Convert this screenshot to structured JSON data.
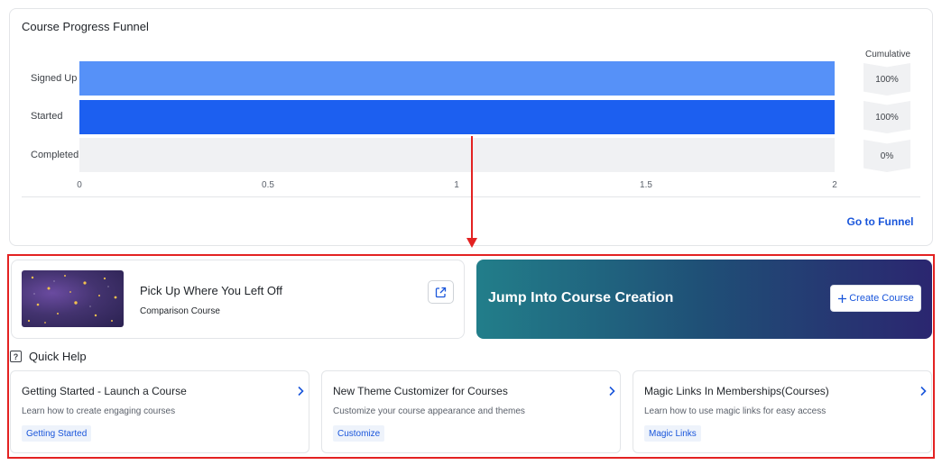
{
  "funnel": {
    "title": "Course Progress Funnel",
    "cumulative_header": "Cumulative",
    "rows": [
      {
        "label": "Signed Up",
        "value": 2,
        "cumulative": "100%",
        "color": "#5691f8"
      },
      {
        "label": "Started",
        "value": 2,
        "cumulative": "100%",
        "color": "#1c5ff0"
      },
      {
        "label": "Completed",
        "value": 0,
        "cumulative": "0%",
        "color": "#f0f1f3"
      }
    ],
    "ticks": [
      "0",
      "0.5",
      "1",
      "1.5",
      "2"
    ],
    "link_label": "Go to Funnel"
  },
  "resume": {
    "title": "Pick Up Where You Left Off",
    "course_name": "Comparison Course",
    "open_icon": "external-link-icon"
  },
  "create": {
    "title": "Jump Into Course Creation",
    "button_label": "Create Course",
    "button_icon": "plus-icon"
  },
  "quick_help": {
    "title": "Quick Help",
    "icon": "question-icon",
    "cards": [
      {
        "title": "Getting Started - Launch a Course",
        "description": "Learn how to create engaging courses",
        "tag": "Getting Started"
      },
      {
        "title": "New Theme Customizer for Courses",
        "description": "Customize your course appearance and themes",
        "tag": "Customize"
      },
      {
        "title": "Magic Links In Memberships(Courses)",
        "description": "Learn how to use magic links for easy access",
        "tag": "Magic Links"
      }
    ]
  },
  "colors": {
    "accent": "#1a56db",
    "annotation": "#e32222"
  }
}
